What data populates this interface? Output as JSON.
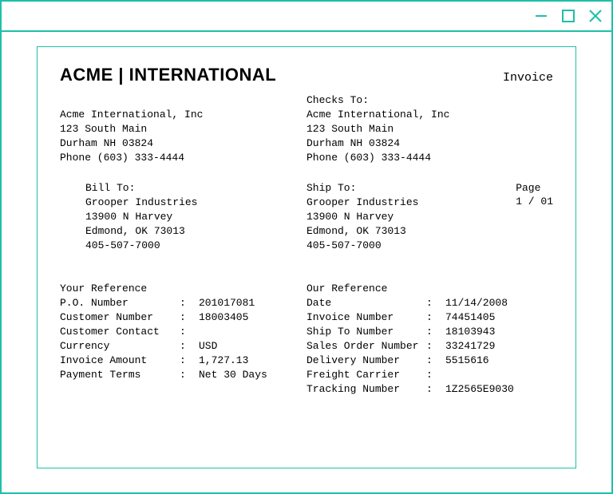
{
  "window": {
    "icons": {
      "minimize": "minimize",
      "maximize": "maximize",
      "close": "close"
    }
  },
  "header": {
    "logo": "ACME | INTERNATIONAL",
    "doc_type": "Invoice"
  },
  "company": {
    "name": "Acme International, Inc",
    "street": "123 South Main",
    "city": "Durham NH 03824",
    "phone": "Phone (603) 333-4444"
  },
  "checks_to": {
    "label": "Checks To:",
    "name": "Acme International, Inc",
    "street": "123 South Main",
    "city": "Durham NH 03824",
    "phone": "Phone (603) 333-4444"
  },
  "bill_to": {
    "label": "Bill To:",
    "name": "Grooper Industries",
    "street": "13900 N Harvey",
    "city": "Edmond, OK 73013",
    "phone": "405-507-7000"
  },
  "ship_to": {
    "label": "Ship To:",
    "name": "Grooper Industries",
    "street": "13900 N Harvey",
    "city": "Edmond, OK 73013",
    "phone": "405-507-7000"
  },
  "page": {
    "label": "Page",
    "value": "1 / 01"
  },
  "your_ref": {
    "title": "Your Reference",
    "rows": [
      {
        "label": "P.O. Number",
        "value": "201017081"
      },
      {
        "label": "Customer Number",
        "value": "18003405"
      },
      {
        "label": "Customer Contact",
        "value": ""
      },
      {
        "label": "Currency",
        "value": "USD"
      },
      {
        "label": "Invoice Amount",
        "value": "1,727.13"
      },
      {
        "label": "Payment Terms",
        "value": "Net 30 Days"
      }
    ]
  },
  "our_ref": {
    "title": "Our Reference",
    "rows": [
      {
        "label": "Date",
        "value": "11/14/2008"
      },
      {
        "label": "Invoice Number",
        "value": "74451405"
      },
      {
        "label": "Ship To Number",
        "value": "18103943"
      },
      {
        "label": "Sales Order Number",
        "value": "33241729"
      },
      {
        "label": "Delivery Number",
        "value": "5515616"
      },
      {
        "label": "Freight Carrier",
        "value": ""
      },
      {
        "label": "Tracking Number",
        "value": "1Z2565E9030"
      }
    ]
  }
}
